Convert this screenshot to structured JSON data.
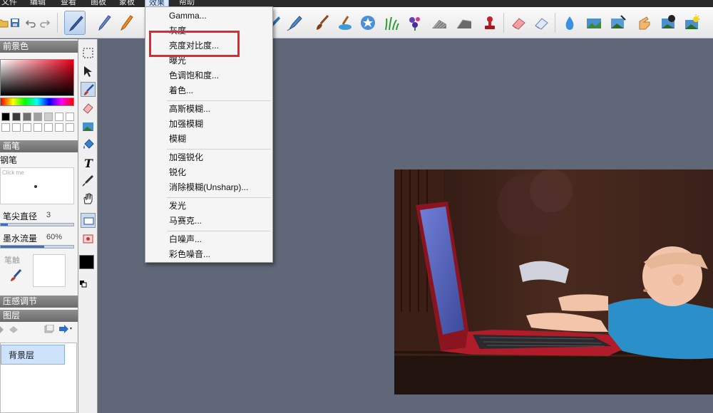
{
  "menubar": {
    "items": [
      "文件",
      "编辑",
      "查看",
      "画板",
      "蒙板",
      "效果",
      "帮助"
    ],
    "active": "效果"
  },
  "left_panel": {
    "foreground_header": "前景色",
    "brush_header": "画笔",
    "brush_name": "钢笔",
    "preview_hint": "Click me",
    "tip_size_label": "笔尖直径",
    "tip_size_value": "3",
    "tip_size_fraction": 0.1,
    "ink_flow_label": "墨水流量",
    "ink_flow_value": "60%",
    "ink_flow_fraction": 0.6,
    "stroke_label": "笔触",
    "pressure_header": "压感调节",
    "layers_header": "图层",
    "layer_name": "背景层"
  },
  "effects_menu": {
    "groups": [
      [
        "Gamma...",
        "灰度",
        "亮度对比度...",
        "曝光",
        "色调饱和度...",
        "着色..."
      ],
      [
        "高斯模糊...",
        "加强模糊",
        "模糊"
      ],
      [
        "加强锐化",
        "锐化",
        "消除模糊(Unsharp)..."
      ],
      [
        "发光",
        "马赛克..."
      ],
      [
        "白噪声...",
        "彩色噪音..."
      ]
    ],
    "highlighted": "亮度对比度..."
  },
  "colors": {
    "menubar_bg": "#2b2b2b",
    "workspace_bg": "#5f6778",
    "highlight_border": "#e8262a",
    "selection_blue": "#3a6fc4"
  },
  "icons": {
    "toolbar": [
      "folder-icon",
      "save-icon",
      "undo-icon",
      "redo-icon",
      "pen-icon",
      "pencil-icon",
      "crayon-icon",
      "airbrush-icon",
      "marker-icon",
      "paint-brush-icon",
      "paint-bucket-icon",
      "star-brush-icon",
      "grass-brush-icon",
      "flower-brush-icon",
      "hatch-brush-icon",
      "texture-brush-icon",
      "stamp-icon",
      "eraser-icon",
      "soft-eraser-icon",
      "water-drop-icon",
      "smudge-icon",
      "image-brush-icon",
      "dodge-icon",
      "finger-icon",
      "burn-icon",
      "sun-icon"
    ],
    "tools": [
      "marquee-select-icon",
      "move-icon",
      "brush-tool-icon",
      "eraser-tool-icon",
      "image-tool-icon",
      "fill-tool-icon",
      "text-tool-icon",
      "eyedropper-icon",
      "hand-icon",
      "rect-shape-icon",
      "image-frame-icon"
    ]
  }
}
